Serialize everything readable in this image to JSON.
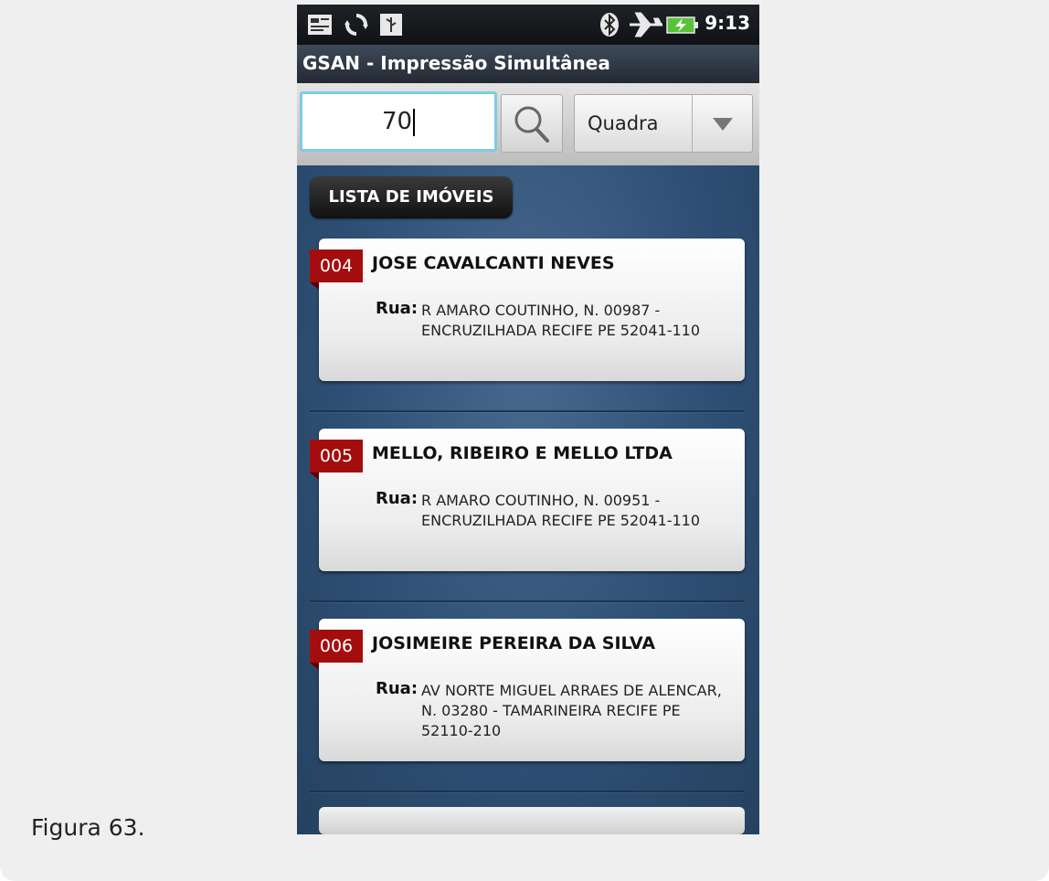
{
  "status_bar": {
    "time": "9:13",
    "icons": [
      "notification-icon",
      "sync-icon",
      "usb-icon",
      "bluetooth-icon",
      "airplane-mode-icon",
      "battery-charging-icon"
    ]
  },
  "app": {
    "title": "GSAN - Impressão Simultânea"
  },
  "search": {
    "value": "70",
    "filter_selected": "Quadra"
  },
  "list": {
    "header": "LISTA DE IMÓVEIS",
    "items": [
      {
        "code": "004",
        "name": "JOSE CAVALCANTI NEVES",
        "address_label": "Rua:",
        "address": "R AMARO COUTINHO, N. 00987 - ENCRUZILHADA RECIFE PE 52041-110"
      },
      {
        "code": "005",
        "name": "MELLO, RIBEIRO E MELLO LTDA",
        "address_label": "Rua:",
        "address": "R AMARO COUTINHO, N. 00951 - ENCRUZILHADA RECIFE PE 52041-110"
      },
      {
        "code": "006",
        "name": "JOSIMEIRE PEREIRA DA SILVA",
        "address_label": "Rua:",
        "address": "AV NORTE MIGUEL ARRAES DE ALENCAR, N. 03280 - TAMARINEIRA RECIFE PE 52110-210"
      }
    ]
  },
  "caption": "Figura 63.",
  "colors": {
    "badge": "#a30d0d",
    "list_background": "#2c4f74",
    "input_focus": "#7ecbe6"
  }
}
